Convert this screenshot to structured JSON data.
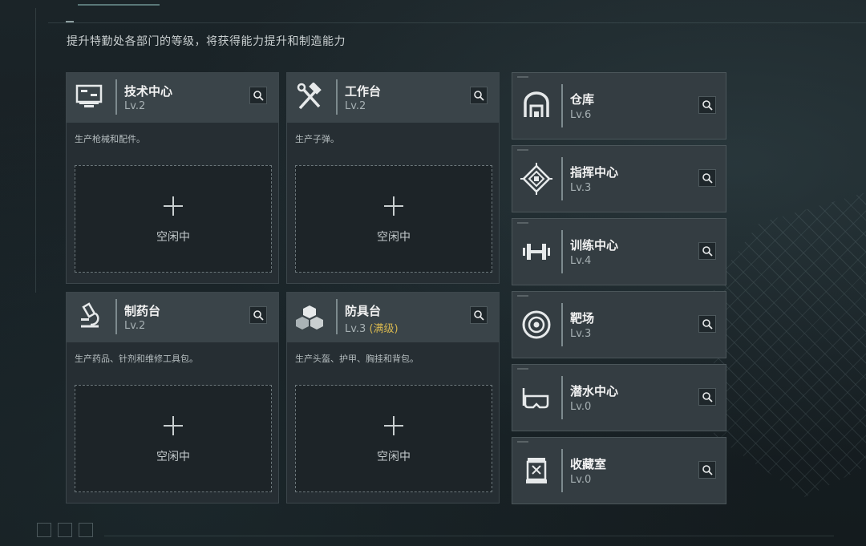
{
  "subtitle": "提升特勤处各部门的等级，将获得能力提升和制造能力",
  "slot_idle_label": "空闲中",
  "production_departments": [
    {
      "name": "技术中心",
      "level": "Lv.2",
      "description": "生产枪械和配件。",
      "icon": "computer-icon"
    },
    {
      "name": "工作台",
      "level": "Lv.2",
      "description": "生产子弹。",
      "icon": "hammer-wrench-icon"
    },
    {
      "name": "制药台",
      "level": "Lv.2",
      "description": "生产药品、针剂和维修工具包。",
      "icon": "microscope-icon"
    },
    {
      "name": "防具台",
      "level": "Lv.3",
      "level_note": "(满级)",
      "description": "生产头盔、护甲、胸挂和背包。",
      "icon": "armor-cubes-icon"
    }
  ],
  "other_departments": [
    {
      "name": "仓库",
      "level": "Lv.6",
      "icon": "warehouse-icon"
    },
    {
      "name": "指挥中心",
      "level": "Lv.3",
      "icon": "command-chip-icon"
    },
    {
      "name": "训练中心",
      "level": "Lv.4",
      "icon": "dumbbell-icon"
    },
    {
      "name": "靶场",
      "level": "Lv.3",
      "icon": "target-icon"
    },
    {
      "name": "潜水中心",
      "level": "Lv.0",
      "icon": "diving-mask-icon"
    },
    {
      "name": "收藏室",
      "level": "Lv.0",
      "icon": "trophy-case-icon"
    }
  ],
  "colors": {
    "max_level": "#d5b64f",
    "card_header": "#3a4449",
    "card_body": "#262e33",
    "background": "#1b2428"
  }
}
